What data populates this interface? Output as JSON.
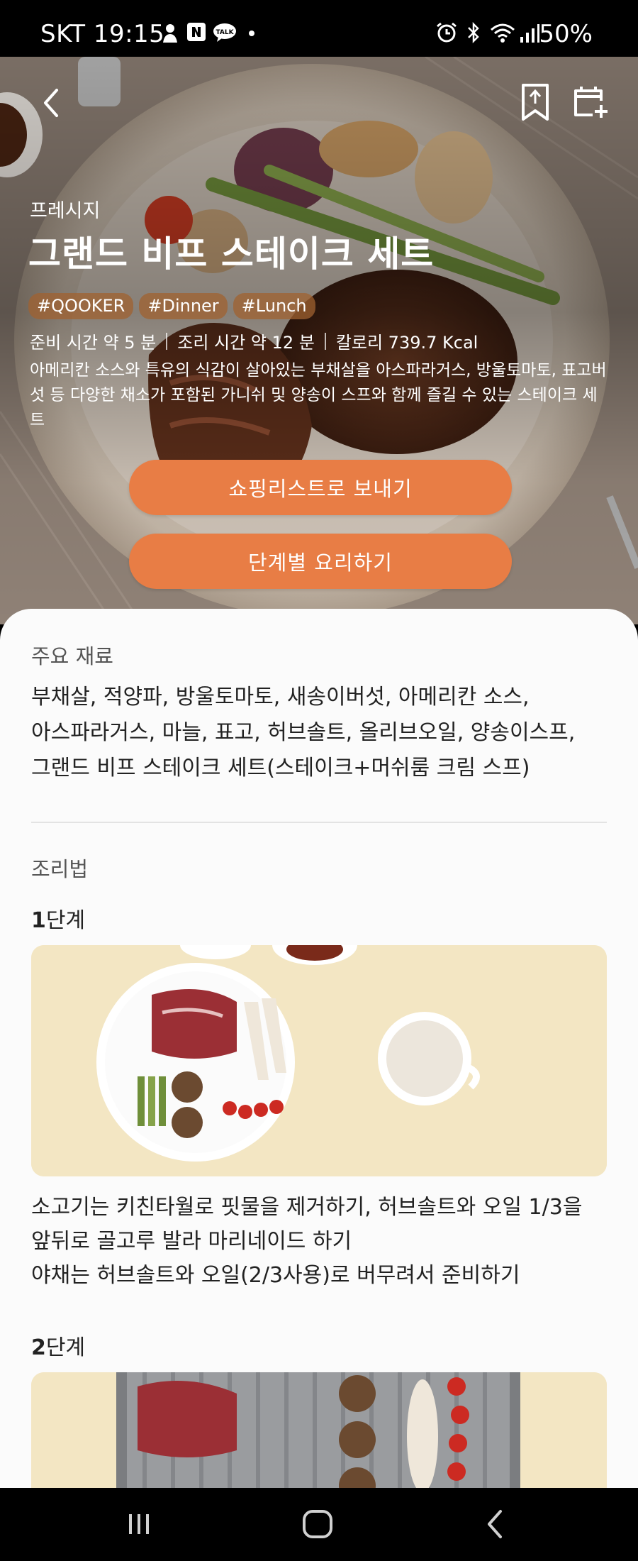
{
  "status_bar": {
    "carrier_time": "SKT 19:15",
    "battery": "50%",
    "icons": [
      "person-icon",
      "naver-icon",
      "kakaotalk-icon",
      "dot-icon",
      "alarm-icon",
      "bluetooth-icon",
      "wifi-icon",
      "signal-icon"
    ]
  },
  "header": {
    "back_icon": "chevron-left-icon",
    "bookmark_icon": "bookmark-icon",
    "calendar_icon": "calendar-add-icon"
  },
  "recipe": {
    "brand": "프레시지",
    "title": "그랜드 비프 스테이크 세트",
    "tags": [
      "#QOOKER",
      "#Dinner",
      "#Lunch"
    ],
    "prep_time": "준비 시간 약 5 분",
    "cook_time": "조리 시간 약 12 분",
    "calories": "칼로리 739.7 Kcal",
    "description": "아메리칸 소스와 특유의 식감이 살아있는 부채살을 아스파라거스, 방울토마토, 표고버섯 등 다양한 채소가 포함된 가니쉬 및 양송이 스프와 함께 즐길 수 있는 스테이크 세트"
  },
  "actions": {
    "send_shopping_list": "쇼핑리스트로 보내기",
    "step_by_step": "단계별 요리하기"
  },
  "ingredients": {
    "label": "주요 재료",
    "lines": [
      "부채살, 적양파, 방울토마토, 새송이버섯, 아메리칸 소스,",
      "아스파라거스, 마늘, 표고, 허브솔트, 올리브오일, 양송이스프,",
      "그랜드 비프 스테이크 세트(스테이크+머쉬룸 크림 스프)"
    ]
  },
  "method": {
    "label": "조리법",
    "steps": [
      {
        "number": "1",
        "suffix": "단계",
        "lines": [
          "소고기는 키친타월로 핏물을 제거하기, 허브솔트와 오일 1/3을",
          "앞뒤로 골고루 발라 마리네이드 하기",
          "야채는 허브솔트와 오일(2/3사용)로 버무려서 준비하기"
        ]
      },
      {
        "number": "2",
        "suffix": "단계",
        "lines": []
      }
    ]
  },
  "nav_bar": {
    "icons": [
      "recent-apps-icon",
      "home-icon",
      "back-icon"
    ]
  },
  "colors": {
    "accent": "#e87d45",
    "tag_bg": "#a06230",
    "card_bg": "#fbfbfb"
  }
}
